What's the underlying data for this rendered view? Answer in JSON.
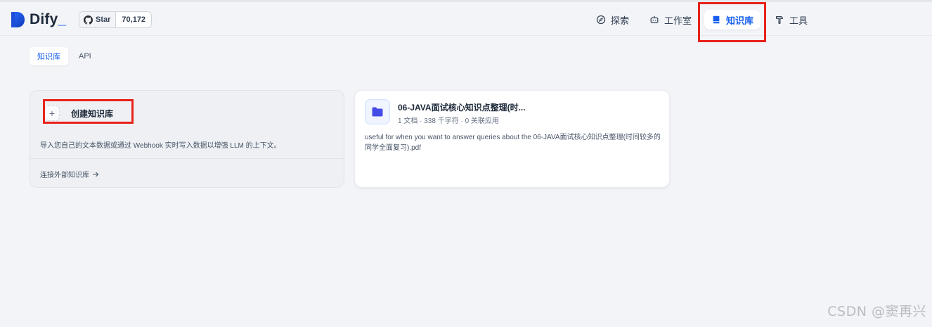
{
  "app": {
    "name": "Dify",
    "underscore": "_"
  },
  "github": {
    "star_label": "Star",
    "star_count": "70,172"
  },
  "nav": {
    "items": [
      {
        "label": "探索",
        "icon": "compass-icon"
      },
      {
        "label": "工作室",
        "icon": "robot-icon"
      },
      {
        "label": "知识库",
        "icon": "book-icon",
        "active": true
      },
      {
        "label": "工具",
        "icon": "hammer-icon"
      }
    ]
  },
  "subtabs": [
    {
      "label": "知识库",
      "active": true
    },
    {
      "label": "API"
    }
  ],
  "create_card": {
    "plus": "+",
    "label": "创建知识库",
    "description": "导入您自己的文本数据或通过 Webhook 实时写入数据以增强 LLM 的上下文。",
    "external_link": "连接外部知识库"
  },
  "datasets": [
    {
      "title": "06-JAVA面试核心知识点整理(时...",
      "meta": "1 文档 · 338 千字符 · 0 关联应用",
      "description": "useful for when you want to answer queries about the 06-JAVA面试核心知识点整理(时间较多的同学全面复习).pdf"
    }
  ],
  "watermark": "CSDN @窦再兴",
  "colors": {
    "accent": "#155eef",
    "highlight_box": "#e8221b",
    "background": "#f2f4f7"
  }
}
